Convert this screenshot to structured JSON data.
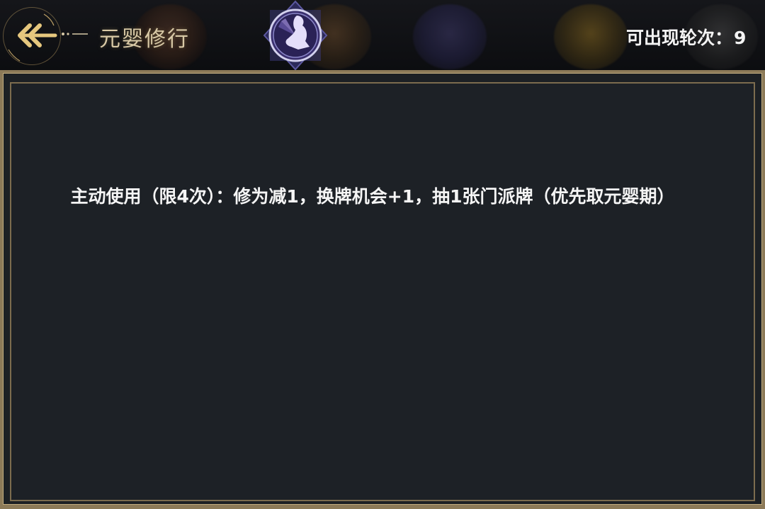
{
  "header": {
    "title": "元婴修行",
    "round_label": "可出现轮次：",
    "round_value": "9"
  },
  "panel": {
    "description": "主动使用（限4次）：修为减1，换牌机会+1，抽1张门派牌（优先取元婴期）"
  },
  "colors": {
    "gold_frame": "#8c7a58",
    "panel_bg": "#1d2126",
    "title_text": "#d8c9a6",
    "emblem_purple": "#3a2f6e"
  },
  "icons": {
    "back": "back-arrow-icon",
    "emblem": "card-emblem-icon"
  }
}
